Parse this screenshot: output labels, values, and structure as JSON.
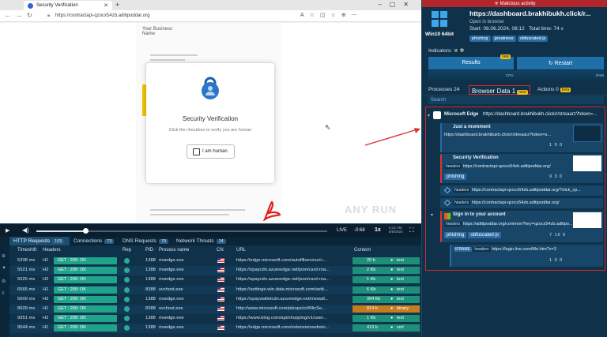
{
  "browser": {
    "tab_title": "Security Verification",
    "url": "https://contractapi-qzocx54zb.aditipoddar.org",
    "document": {
      "line1": "Your Business",
      "line2": "Name"
    },
    "card": {
      "title": "Security Verification",
      "subtitle": "Click the checkbox to verify you are human",
      "button_label": "I am human"
    },
    "watermark": "ANY RUN"
  },
  "player": {
    "live_label": "LIVE",
    "time": "-0:68",
    "speed": "1x",
    "clock": "2:12 AM\n6/8/2024"
  },
  "bottom_tabs": [
    {
      "label": "HTTP Requests",
      "count": "109"
    },
    {
      "label": "Connections",
      "count": "73"
    },
    {
      "label": "DNS Requests",
      "count": "79"
    },
    {
      "label": "Network Threats",
      "count": "14"
    }
  ],
  "table": {
    "headers": [
      "Timeshift",
      "Headers",
      "Rep",
      "PID",
      "Process name",
      "CN",
      "URL",
      "Content"
    ],
    "rows": [
      {
        "time": "5338 ms",
        "ver": "H1",
        "status": "GET : 200: OK",
        "pid": "1388",
        "proc": "msedge.exe",
        "url": "https://edge.microsoft.com/autofillservice/c...",
        "size": "20 b",
        "type": "text"
      },
      {
        "time": "5521 ms",
        "ver": "H2",
        "status": "GET : 200: OK",
        "pid": "1388",
        "proc": "msedge.exe",
        "url": "https://xpaycdn.azureedge.net/json/card-roa...",
        "size": "2 Kb",
        "type": "text"
      },
      {
        "time": "5525 ms",
        "ver": "H2",
        "status": "GET : 200: OK",
        "pid": "1388",
        "proc": "msedge.exe",
        "url": "https://xpaycdn.azureedge.net/json/card-roa...",
        "size": "1 Kb",
        "type": "text"
      },
      {
        "time": "6565 ms",
        "ver": "H1",
        "status": "GET : 200: OK",
        "pid": "8388",
        "proc": "svchost.exe",
        "url": "https://settings-win.data.microsoft.com/setti...",
        "size": "6 Kb",
        "type": "text"
      },
      {
        "time": "5609 ms",
        "ver": "H2",
        "status": "GET : 200: OK",
        "pid": "1388",
        "proc": "msedge.exe",
        "url": "https://xpaywalletcdn.azureedge.net/mswall...",
        "size": "394 Kb",
        "type": "text"
      },
      {
        "time": "8929 ms",
        "ver": "H1",
        "status": "GET : 200: OK",
        "pid": "8388",
        "proc": "svchost.exe",
        "url": "http://www.microsoft.com/pkiops/crl/MicSe...",
        "size": "814 b",
        "type": "binary"
      },
      {
        "time": "9351 ms",
        "ver": "H2",
        "status": "GET : 200: OK",
        "pid": "1388",
        "proc": "msedge.exe",
        "url": "https://www.bing.com/api/shopping/v1/user...",
        "size": "1 Kb",
        "type": "text"
      },
      {
        "time": "9544 ms",
        "ver": "H1",
        "status": "GET : 200: OK",
        "pid": "1388",
        "proc": "msedge.exe",
        "url": "https://edge.microsoft.com/extensionwebsto...",
        "size": "413 b",
        "type": "xml"
      }
    ]
  },
  "right": {
    "banner": "Malicious activity",
    "os": "Win10 64bit",
    "title_url": "https://dashboard.brakhibukh.click/r...",
    "open_in": "Open in browser",
    "start_line": "Start: 08.06.2024, 08:12   Total time: 74 s",
    "tags": [
      "phishing",
      "greatness",
      "obfuscated-js"
    ],
    "indicators_label": "Indicators:",
    "results_label": "Results",
    "restart_label": "Restart",
    "new_badge": "new",
    "cpu_label": "CPU",
    "ram_label": "RAM",
    "tabs": {
      "processes": "Processes 24",
      "browser_data": "Browser Data",
      "browser_data_count": "1",
      "actions": "Actions",
      "actions_count": "0",
      "beta": "beta"
    },
    "search_placeholder": "Search",
    "tree": {
      "app": "Microsoft Edge",
      "app_url": "https://dashboard.brakhibukh.click/r/streaarz?token=...",
      "n1_title": "Just a momment",
      "n1_url": "https://dashboard.brakhibukh.click/r/streaarz?token=s...",
      "n1_counts": "1   0   0",
      "n2_title": "Security Verification",
      "n2_url": "https://contractapi-qzocx54zb.aditipoddar.org/",
      "n2_tag": "phishing",
      "n2_counts": "9   3   0",
      "n3_url": "https://contractapi-qzocx54zb.aditipoddar.org/?click_cp...",
      "n4_url": "https://contractapi-qzocx54zb.aditipoddar.org/",
      "n5_title": "Sign in to your account",
      "n5_url": "https://aditipoddar.org/common?key=qzocx54zb.aditipo...",
      "n5_tags": [
        "phishing",
        "obfuscated-js"
      ],
      "n5_counts": "7   16   5",
      "iframe_label": "IFRAME",
      "iframe_url": "https://login.live.com/Me.htm?v=3",
      "iframe_counts": "1   0   0",
      "headers_label": "headers"
    }
  }
}
